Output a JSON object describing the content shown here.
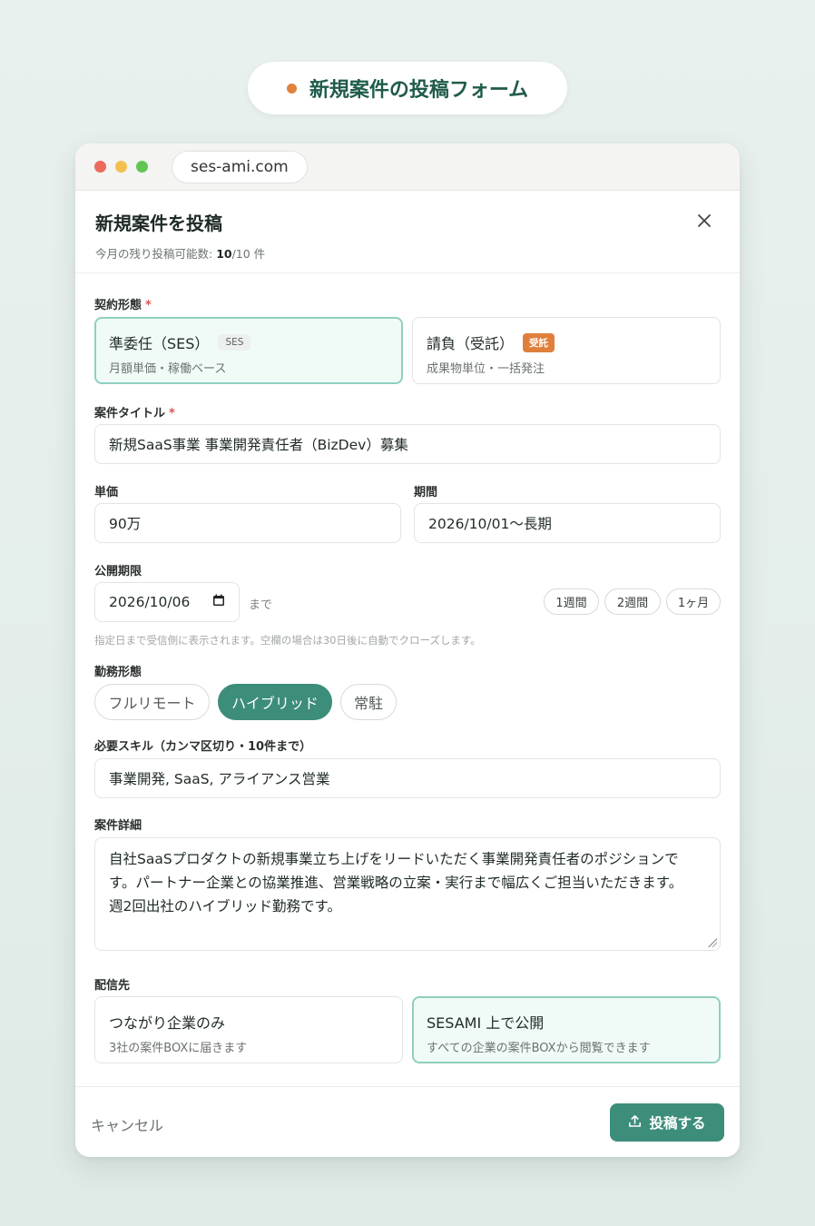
{
  "hero": {
    "title": "新規案件の投稿フォーム"
  },
  "browser": {
    "url": "ses-ami.com"
  },
  "modal": {
    "title": "新規案件を投稿",
    "quota_prefix": "今月の残り投稿可能数: ",
    "quota_value": "10",
    "quota_suffix": "/10 件"
  },
  "contract": {
    "label": "契約形態",
    "required_mark": "*",
    "options": [
      {
        "title": "準委任（SES）",
        "badge": "SES",
        "sub": "月額単価・稼働ベース",
        "selected": true
      },
      {
        "title": "請負（受託）",
        "badge": "受託",
        "sub": "成果物単位・一括発注",
        "selected": false
      }
    ]
  },
  "title_field": {
    "label": "案件タイトル",
    "required_mark": "*",
    "value": "新規SaaS事業 事業開発責任者（BizDev）募集"
  },
  "price": {
    "label": "単価",
    "value": "90万"
  },
  "period": {
    "label": "期間",
    "value": "2026/10/01〜長期"
  },
  "deadline": {
    "label": "公開期限",
    "value": "2026/10/06",
    "suffix": "まで",
    "chips": [
      "1週間",
      "2週間",
      "1ヶ月"
    ],
    "hint": "指定日まで受信側に表示されます。空欄の場合は30日後に自動でクローズします。"
  },
  "work_style": {
    "label": "勤務形態",
    "options": [
      "フルリモート",
      "ハイブリッド",
      "常駐"
    ],
    "selected": "ハイブリッド"
  },
  "skills": {
    "label": "必要スキル（カンマ区切り・10件まで）",
    "value": "事業開発, SaaS, アライアンス営業"
  },
  "details": {
    "label": "案件詳細",
    "lines": [
      "自社SaaSプロダクトの新規事業立ち上げをリードいただく事業開発責任者のポジションで",
      "す。パートナー企業との協業推進、営業戦略の立案・実行まで幅広くご担当いただきます。",
      "週2回出社のハイブリッド勤務です。"
    ]
  },
  "distribution": {
    "label": "配信先",
    "options": [
      {
        "title": "つながり企業のみ",
        "sub": "3社の案件BOXに届きます",
        "selected": false
      },
      {
        "title": "SESAMI 上で公開",
        "sub": "すべての企業の案件BOXから閲覧できます",
        "selected": true
      }
    ]
  },
  "footer": {
    "cancel": "キャンセル",
    "submit": "投稿する"
  },
  "colors": {
    "accent": "#3d8d7b",
    "orange": "#e0823d",
    "selected_border": "#8fcfbf"
  },
  "icons": {
    "close": "close-icon",
    "upload": "upload-icon",
    "calendar": "calendar-icon"
  }
}
